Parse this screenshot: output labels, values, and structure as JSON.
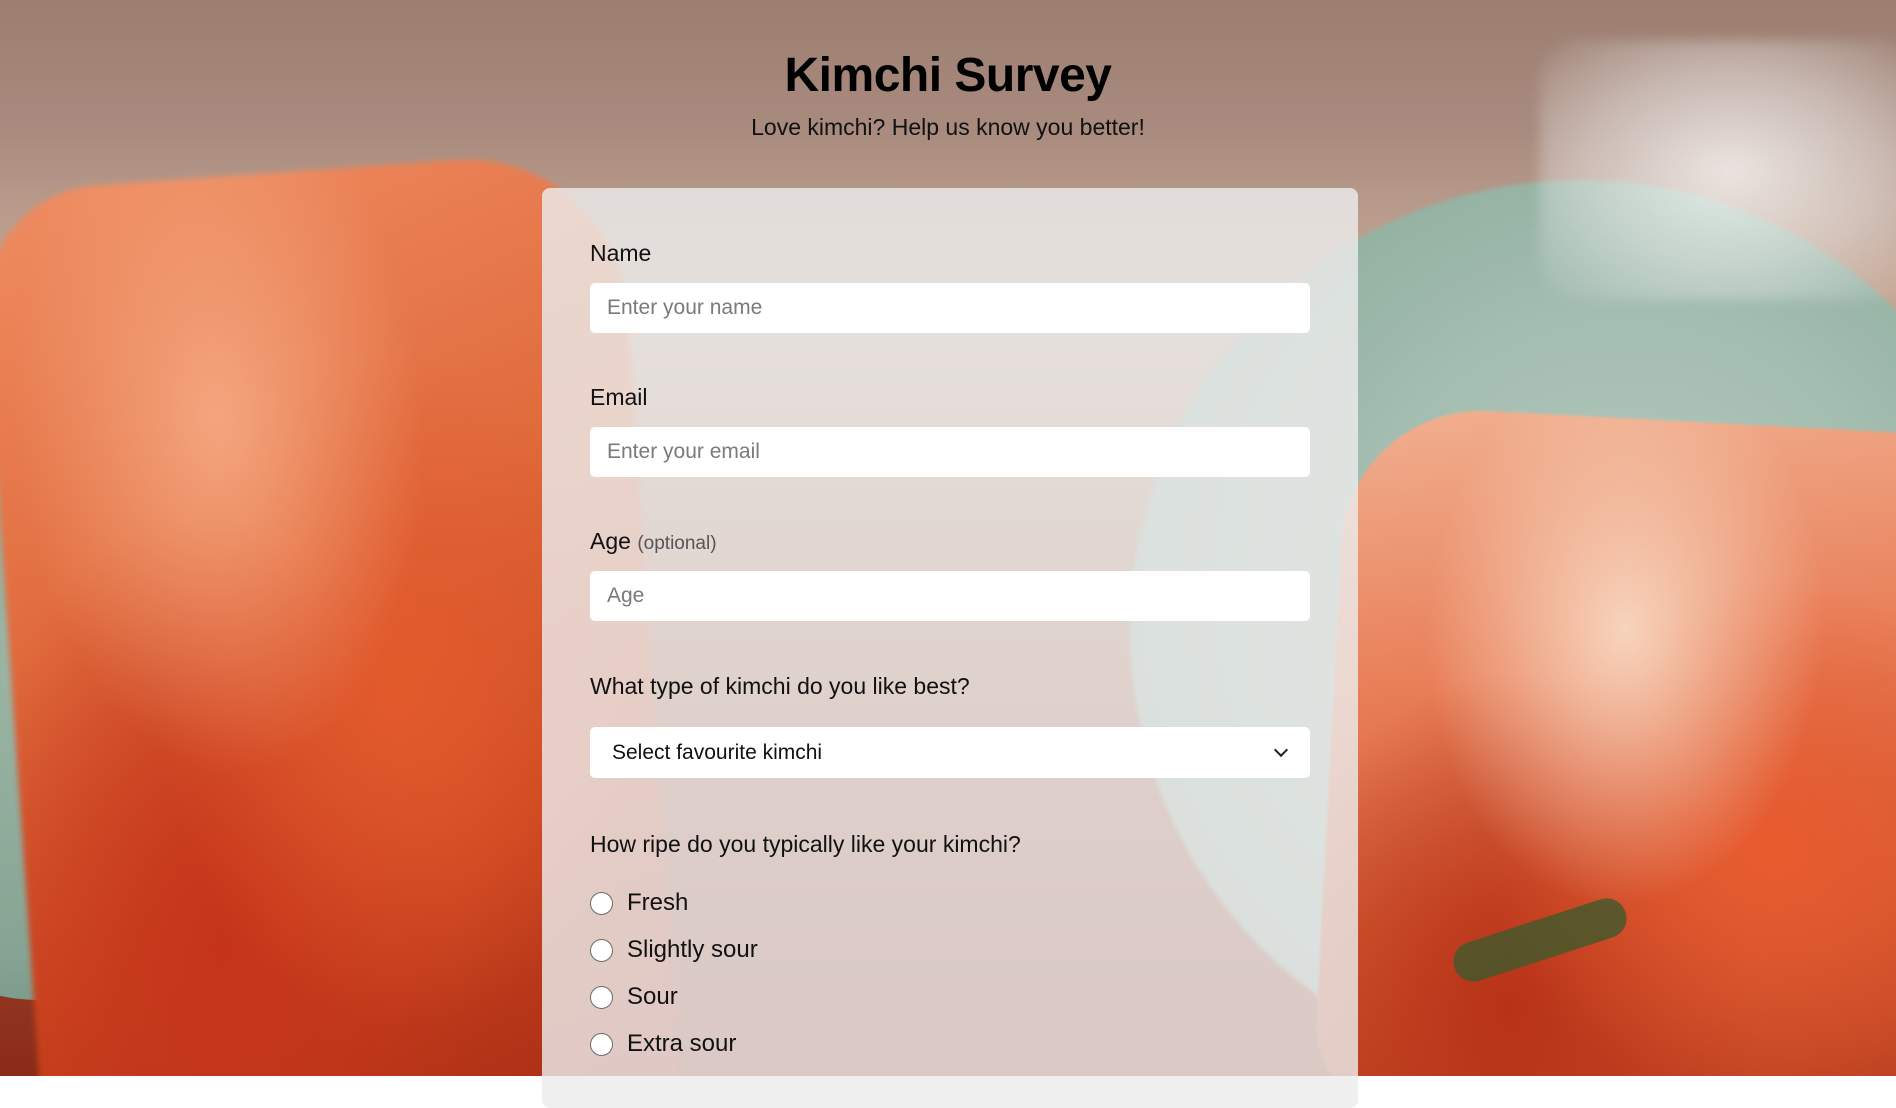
{
  "header": {
    "title": "Kimchi Survey",
    "subtitle": "Love kimchi? Help us know you better!"
  },
  "form": {
    "name": {
      "label": "Name",
      "placeholder": "Enter your name",
      "value": ""
    },
    "email": {
      "label": "Email",
      "placeholder": "Enter your email",
      "value": ""
    },
    "age": {
      "label": "Age",
      "optional_note": "(optional)",
      "placeholder": "Age",
      "value": ""
    },
    "favorite": {
      "label": "What type of kimchi do you like best?",
      "selected": "Select favourite kimchi"
    },
    "ripeness": {
      "label": "How ripe do you typically like your kimchi?",
      "options": [
        {
          "label": "Fresh",
          "checked": false
        },
        {
          "label": "Slightly sour",
          "checked": false
        },
        {
          "label": "Sour",
          "checked": false
        },
        {
          "label": "Extra sour",
          "checked": false
        }
      ]
    }
  },
  "colors": {
    "card_background": "#ececec",
    "input_background": "#ffffff",
    "text": "#111111"
  },
  "icons": {
    "select_arrow": "chevron-down-icon",
    "radio": "radio-circle-icon"
  }
}
